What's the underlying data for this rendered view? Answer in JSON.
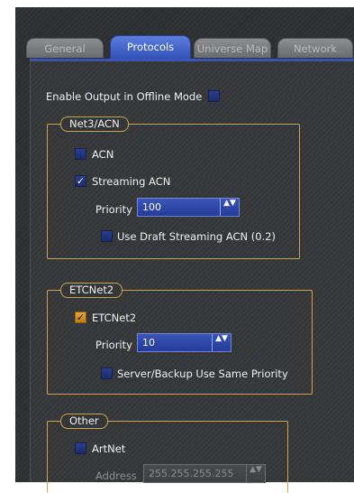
{
  "tabs": [
    {
      "label": "General"
    },
    {
      "label": "Protocols"
    },
    {
      "label": "Universe Map"
    },
    {
      "label": "Network"
    }
  ],
  "offline": {
    "label": "Enable Output in Offline Mode",
    "checked": false
  },
  "net3": {
    "title": "Net3/ACN",
    "acn_label": "ACN",
    "streaming_label": "Streaming ACN",
    "priority_label": "Priority",
    "priority_value": "100",
    "draft_label": "Use Draft Streaming ACN (0.2)",
    "check_mark": "✓"
  },
  "etcnet2": {
    "title": "ETCNet2",
    "enable_label": "ETCNet2",
    "priority_label": "Priority",
    "priority_value": "10",
    "backup_label": "Server/Backup Use Same Priority",
    "check_mark": "✓"
  },
  "other": {
    "title": "Other",
    "artnet_label": "ArtNet",
    "address_label": "Address",
    "address_value": "255.255.255.255"
  },
  "spinner_glyph": "▲▼"
}
